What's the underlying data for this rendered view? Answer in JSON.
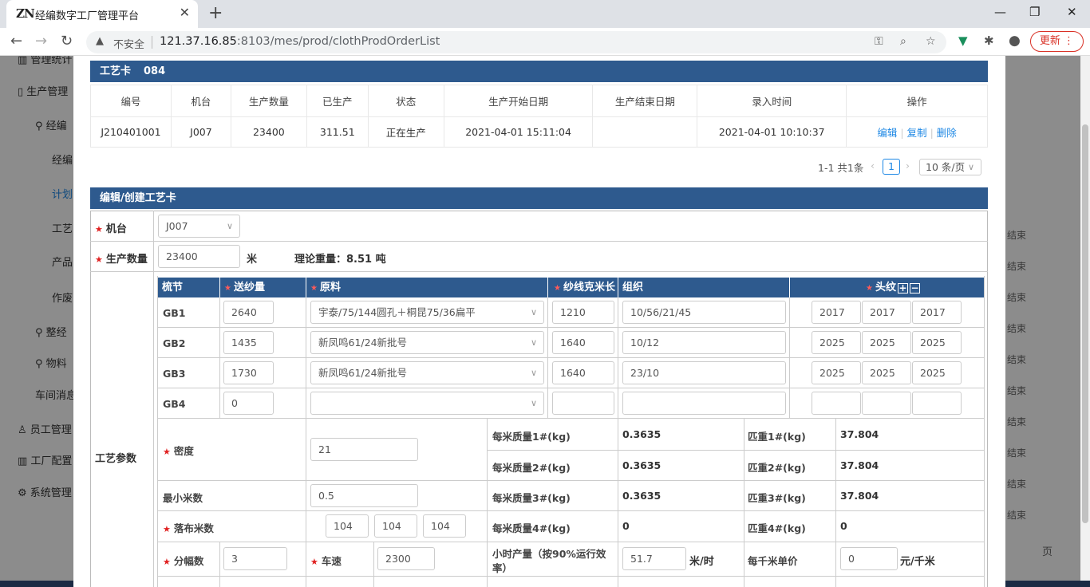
{
  "browser": {
    "tab_logo": "ZN",
    "tab_title": "经编数字工厂管理平台",
    "tab_close": "✕",
    "new_tab": "+",
    "win_min": "—",
    "win_max": "❐",
    "win_close": "✕",
    "back": "←",
    "forward": "→",
    "reload": "↻",
    "security_label": "不安全",
    "url_host": "121.37.16.85",
    "url_rest": ":8103/mes/prod/clothProdOrderList",
    "update_label": "更新 ⋮"
  },
  "sidebar": {
    "items": [
      "管理统计",
      "生产管理",
      "经编",
      "经编",
      "计划",
      "工艺",
      "产品",
      "作废",
      "整经",
      "物料",
      "车间消息",
      "员工管理",
      "工厂配置",
      "系统管理"
    ]
  },
  "background": {
    "status_col": [
      "结束",
      "结束",
      "结束",
      "结束",
      "结束",
      "结束",
      "结束",
      "结束",
      "结束",
      "结束"
    ],
    "page_suffix": "页"
  },
  "card_section": {
    "title": "工艺卡",
    "card_no": "084"
  },
  "order_table": {
    "headers": [
      "编号",
      "机台",
      "生产数量",
      "已生产",
      "状态",
      "生产开始日期",
      "生产结束日期",
      "录入时间",
      "操作"
    ],
    "rows": [
      {
        "code": "J210401001",
        "machine": "J007",
        "qty": "23400",
        "produced": "311.51",
        "status": "正在生产",
        "start": "2021-04-01 15:11:04",
        "end": "",
        "entered": "2021-04-01 10:10:37"
      }
    ],
    "actions": [
      "编辑",
      "复制",
      "删除"
    ]
  },
  "pagination": {
    "summary": "1-1 共1条",
    "prev": "‹",
    "current": "1",
    "next": "›",
    "page_size": "10 条/页"
  },
  "edit_section": {
    "title": "编辑/创建工艺卡",
    "machine_label": "机台",
    "machine_value": "J007",
    "qty_label": "生产数量",
    "qty_value": "23400",
    "qty_unit": "米",
    "theory_weight": "理论重量：8.51 吨",
    "process_label": "工艺参数"
  },
  "guide_bar": {
    "headers": [
      "梳节",
      "送纱量",
      "原料",
      "纱线克米长",
      "组织",
      "头纹"
    ],
    "rows": [
      {
        "bar": "GB1",
        "feed": "2640",
        "material": "宇泰/75/144圆孔＋桐昆75/36扁平",
        "gm": "1210",
        "pattern": "10/56/21/45",
        "heads": [
          "2017",
          "2017",
          "2017"
        ]
      },
      {
        "bar": "GB2",
        "feed": "1435",
        "material": "新凤鸣61/24新批号",
        "gm": "1640",
        "pattern": "10/12",
        "heads": [
          "2025",
          "2025",
          "2025"
        ]
      },
      {
        "bar": "GB3",
        "feed": "1730",
        "material": "新凤鸣61/24新批号",
        "gm": "1640",
        "pattern": "23/10",
        "heads": [
          "2025",
          "2025",
          "2025"
        ]
      },
      {
        "bar": "GB4",
        "feed": "0",
        "material": "",
        "gm": "",
        "pattern": "",
        "heads": [
          "",
          "",
          ""
        ]
      }
    ]
  },
  "params": {
    "density_label": "密度",
    "density": "21",
    "min_meter_label": "最小米数",
    "min_meter": "0.5",
    "drop_label": "落布米数",
    "drops": [
      "104",
      "104",
      "104"
    ],
    "split_label": "分幅数",
    "split": "3",
    "speed_label": "车速",
    "speed": "2300",
    "mass": [
      {
        "label": "每米质量1#(kg)",
        "value": "0.3635",
        "piece_label": "匹重1#(kg)",
        "piece": "37.804"
      },
      {
        "label": "每米质量2#(kg)",
        "value": "0.3635",
        "piece_label": "匹重2#(kg)",
        "piece": "37.804"
      },
      {
        "label": "每米质量3#(kg)",
        "value": "0.3635",
        "piece_label": "匹重3#(kg)",
        "piece": "37.804"
      },
      {
        "label": "每米质量4#(kg)",
        "value": "0",
        "piece_label": "匹重4#(kg)",
        "piece": "0"
      }
    ],
    "hourly_label_1": "小时产量（按90%运行效",
    "hourly_label_2": "率）",
    "hourly": "51.7",
    "hourly_unit": "米/时",
    "price_label": "每千米单价",
    "price": "0",
    "price_unit": "元/千米"
  }
}
